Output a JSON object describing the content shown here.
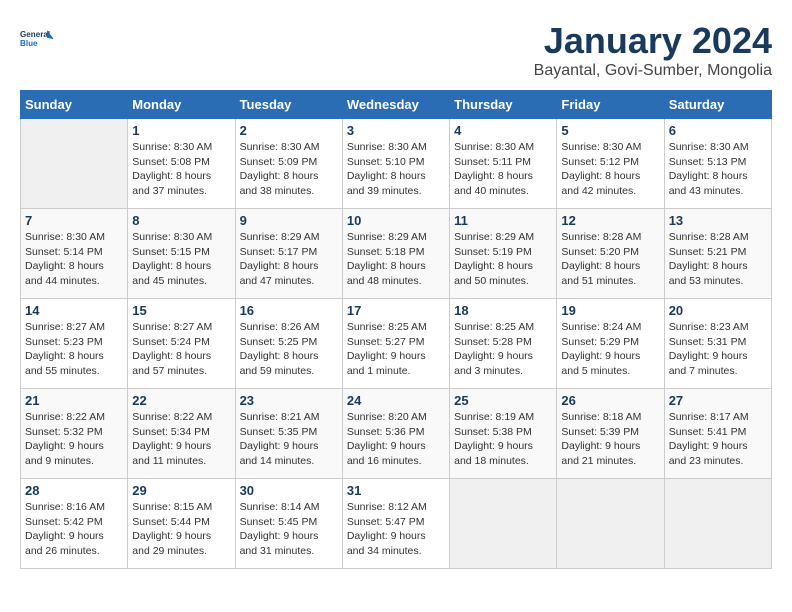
{
  "logo": {
    "line1": "General",
    "line2": "Blue"
  },
  "title": "January 2024",
  "subtitle": "Bayantal, Govi-Sumber, Mongolia",
  "weekdays": [
    "Sunday",
    "Monday",
    "Tuesday",
    "Wednesday",
    "Thursday",
    "Friday",
    "Saturday"
  ],
  "weeks": [
    [
      {
        "day": null,
        "sunrise": null,
        "sunset": null,
        "daylight": null
      },
      {
        "day": "1",
        "sunrise": "Sunrise: 8:30 AM",
        "sunset": "Sunset: 5:08 PM",
        "daylight": "Daylight: 8 hours and 37 minutes."
      },
      {
        "day": "2",
        "sunrise": "Sunrise: 8:30 AM",
        "sunset": "Sunset: 5:09 PM",
        "daylight": "Daylight: 8 hours and 38 minutes."
      },
      {
        "day": "3",
        "sunrise": "Sunrise: 8:30 AM",
        "sunset": "Sunset: 5:10 PM",
        "daylight": "Daylight: 8 hours and 39 minutes."
      },
      {
        "day": "4",
        "sunrise": "Sunrise: 8:30 AM",
        "sunset": "Sunset: 5:11 PM",
        "daylight": "Daylight: 8 hours and 40 minutes."
      },
      {
        "day": "5",
        "sunrise": "Sunrise: 8:30 AM",
        "sunset": "Sunset: 5:12 PM",
        "daylight": "Daylight: 8 hours and 42 minutes."
      },
      {
        "day": "6",
        "sunrise": "Sunrise: 8:30 AM",
        "sunset": "Sunset: 5:13 PM",
        "daylight": "Daylight: 8 hours and 43 minutes."
      }
    ],
    [
      {
        "day": "7",
        "sunrise": "Sunrise: 8:30 AM",
        "sunset": "Sunset: 5:14 PM",
        "daylight": "Daylight: 8 hours and 44 minutes."
      },
      {
        "day": "8",
        "sunrise": "Sunrise: 8:30 AM",
        "sunset": "Sunset: 5:15 PM",
        "daylight": "Daylight: 8 hours and 45 minutes."
      },
      {
        "day": "9",
        "sunrise": "Sunrise: 8:29 AM",
        "sunset": "Sunset: 5:17 PM",
        "daylight": "Daylight: 8 hours and 47 minutes."
      },
      {
        "day": "10",
        "sunrise": "Sunrise: 8:29 AM",
        "sunset": "Sunset: 5:18 PM",
        "daylight": "Daylight: 8 hours and 48 minutes."
      },
      {
        "day": "11",
        "sunrise": "Sunrise: 8:29 AM",
        "sunset": "Sunset: 5:19 PM",
        "daylight": "Daylight: 8 hours and 50 minutes."
      },
      {
        "day": "12",
        "sunrise": "Sunrise: 8:28 AM",
        "sunset": "Sunset: 5:20 PM",
        "daylight": "Daylight: 8 hours and 51 minutes."
      },
      {
        "day": "13",
        "sunrise": "Sunrise: 8:28 AM",
        "sunset": "Sunset: 5:21 PM",
        "daylight": "Daylight: 8 hours and 53 minutes."
      }
    ],
    [
      {
        "day": "14",
        "sunrise": "Sunrise: 8:27 AM",
        "sunset": "Sunset: 5:23 PM",
        "daylight": "Daylight: 8 hours and 55 minutes."
      },
      {
        "day": "15",
        "sunrise": "Sunrise: 8:27 AM",
        "sunset": "Sunset: 5:24 PM",
        "daylight": "Daylight: 8 hours and 57 minutes."
      },
      {
        "day": "16",
        "sunrise": "Sunrise: 8:26 AM",
        "sunset": "Sunset: 5:25 PM",
        "daylight": "Daylight: 8 hours and 59 minutes."
      },
      {
        "day": "17",
        "sunrise": "Sunrise: 8:25 AM",
        "sunset": "Sunset: 5:27 PM",
        "daylight": "Daylight: 9 hours and 1 minute."
      },
      {
        "day": "18",
        "sunrise": "Sunrise: 8:25 AM",
        "sunset": "Sunset: 5:28 PM",
        "daylight": "Daylight: 9 hours and 3 minutes."
      },
      {
        "day": "19",
        "sunrise": "Sunrise: 8:24 AM",
        "sunset": "Sunset: 5:29 PM",
        "daylight": "Daylight: 9 hours and 5 minutes."
      },
      {
        "day": "20",
        "sunrise": "Sunrise: 8:23 AM",
        "sunset": "Sunset: 5:31 PM",
        "daylight": "Daylight: 9 hours and 7 minutes."
      }
    ],
    [
      {
        "day": "21",
        "sunrise": "Sunrise: 8:22 AM",
        "sunset": "Sunset: 5:32 PM",
        "daylight": "Daylight: 9 hours and 9 minutes."
      },
      {
        "day": "22",
        "sunrise": "Sunrise: 8:22 AM",
        "sunset": "Sunset: 5:34 PM",
        "daylight": "Daylight: 9 hours and 11 minutes."
      },
      {
        "day": "23",
        "sunrise": "Sunrise: 8:21 AM",
        "sunset": "Sunset: 5:35 PM",
        "daylight": "Daylight: 9 hours and 14 minutes."
      },
      {
        "day": "24",
        "sunrise": "Sunrise: 8:20 AM",
        "sunset": "Sunset: 5:36 PM",
        "daylight": "Daylight: 9 hours and 16 minutes."
      },
      {
        "day": "25",
        "sunrise": "Sunrise: 8:19 AM",
        "sunset": "Sunset: 5:38 PM",
        "daylight": "Daylight: 9 hours and 18 minutes."
      },
      {
        "day": "26",
        "sunrise": "Sunrise: 8:18 AM",
        "sunset": "Sunset: 5:39 PM",
        "daylight": "Daylight: 9 hours and 21 minutes."
      },
      {
        "day": "27",
        "sunrise": "Sunrise: 8:17 AM",
        "sunset": "Sunset: 5:41 PM",
        "daylight": "Daylight: 9 hours and 23 minutes."
      }
    ],
    [
      {
        "day": "28",
        "sunrise": "Sunrise: 8:16 AM",
        "sunset": "Sunset: 5:42 PM",
        "daylight": "Daylight: 9 hours and 26 minutes."
      },
      {
        "day": "29",
        "sunrise": "Sunrise: 8:15 AM",
        "sunset": "Sunset: 5:44 PM",
        "daylight": "Daylight: 9 hours and 29 minutes."
      },
      {
        "day": "30",
        "sunrise": "Sunrise: 8:14 AM",
        "sunset": "Sunset: 5:45 PM",
        "daylight": "Daylight: 9 hours and 31 minutes."
      },
      {
        "day": "31",
        "sunrise": "Sunrise: 8:12 AM",
        "sunset": "Sunset: 5:47 PM",
        "daylight": "Daylight: 9 hours and 34 minutes."
      },
      {
        "day": null,
        "sunrise": null,
        "sunset": null,
        "daylight": null
      },
      {
        "day": null,
        "sunrise": null,
        "sunset": null,
        "daylight": null
      },
      {
        "day": null,
        "sunrise": null,
        "sunset": null,
        "daylight": null
      }
    ]
  ]
}
